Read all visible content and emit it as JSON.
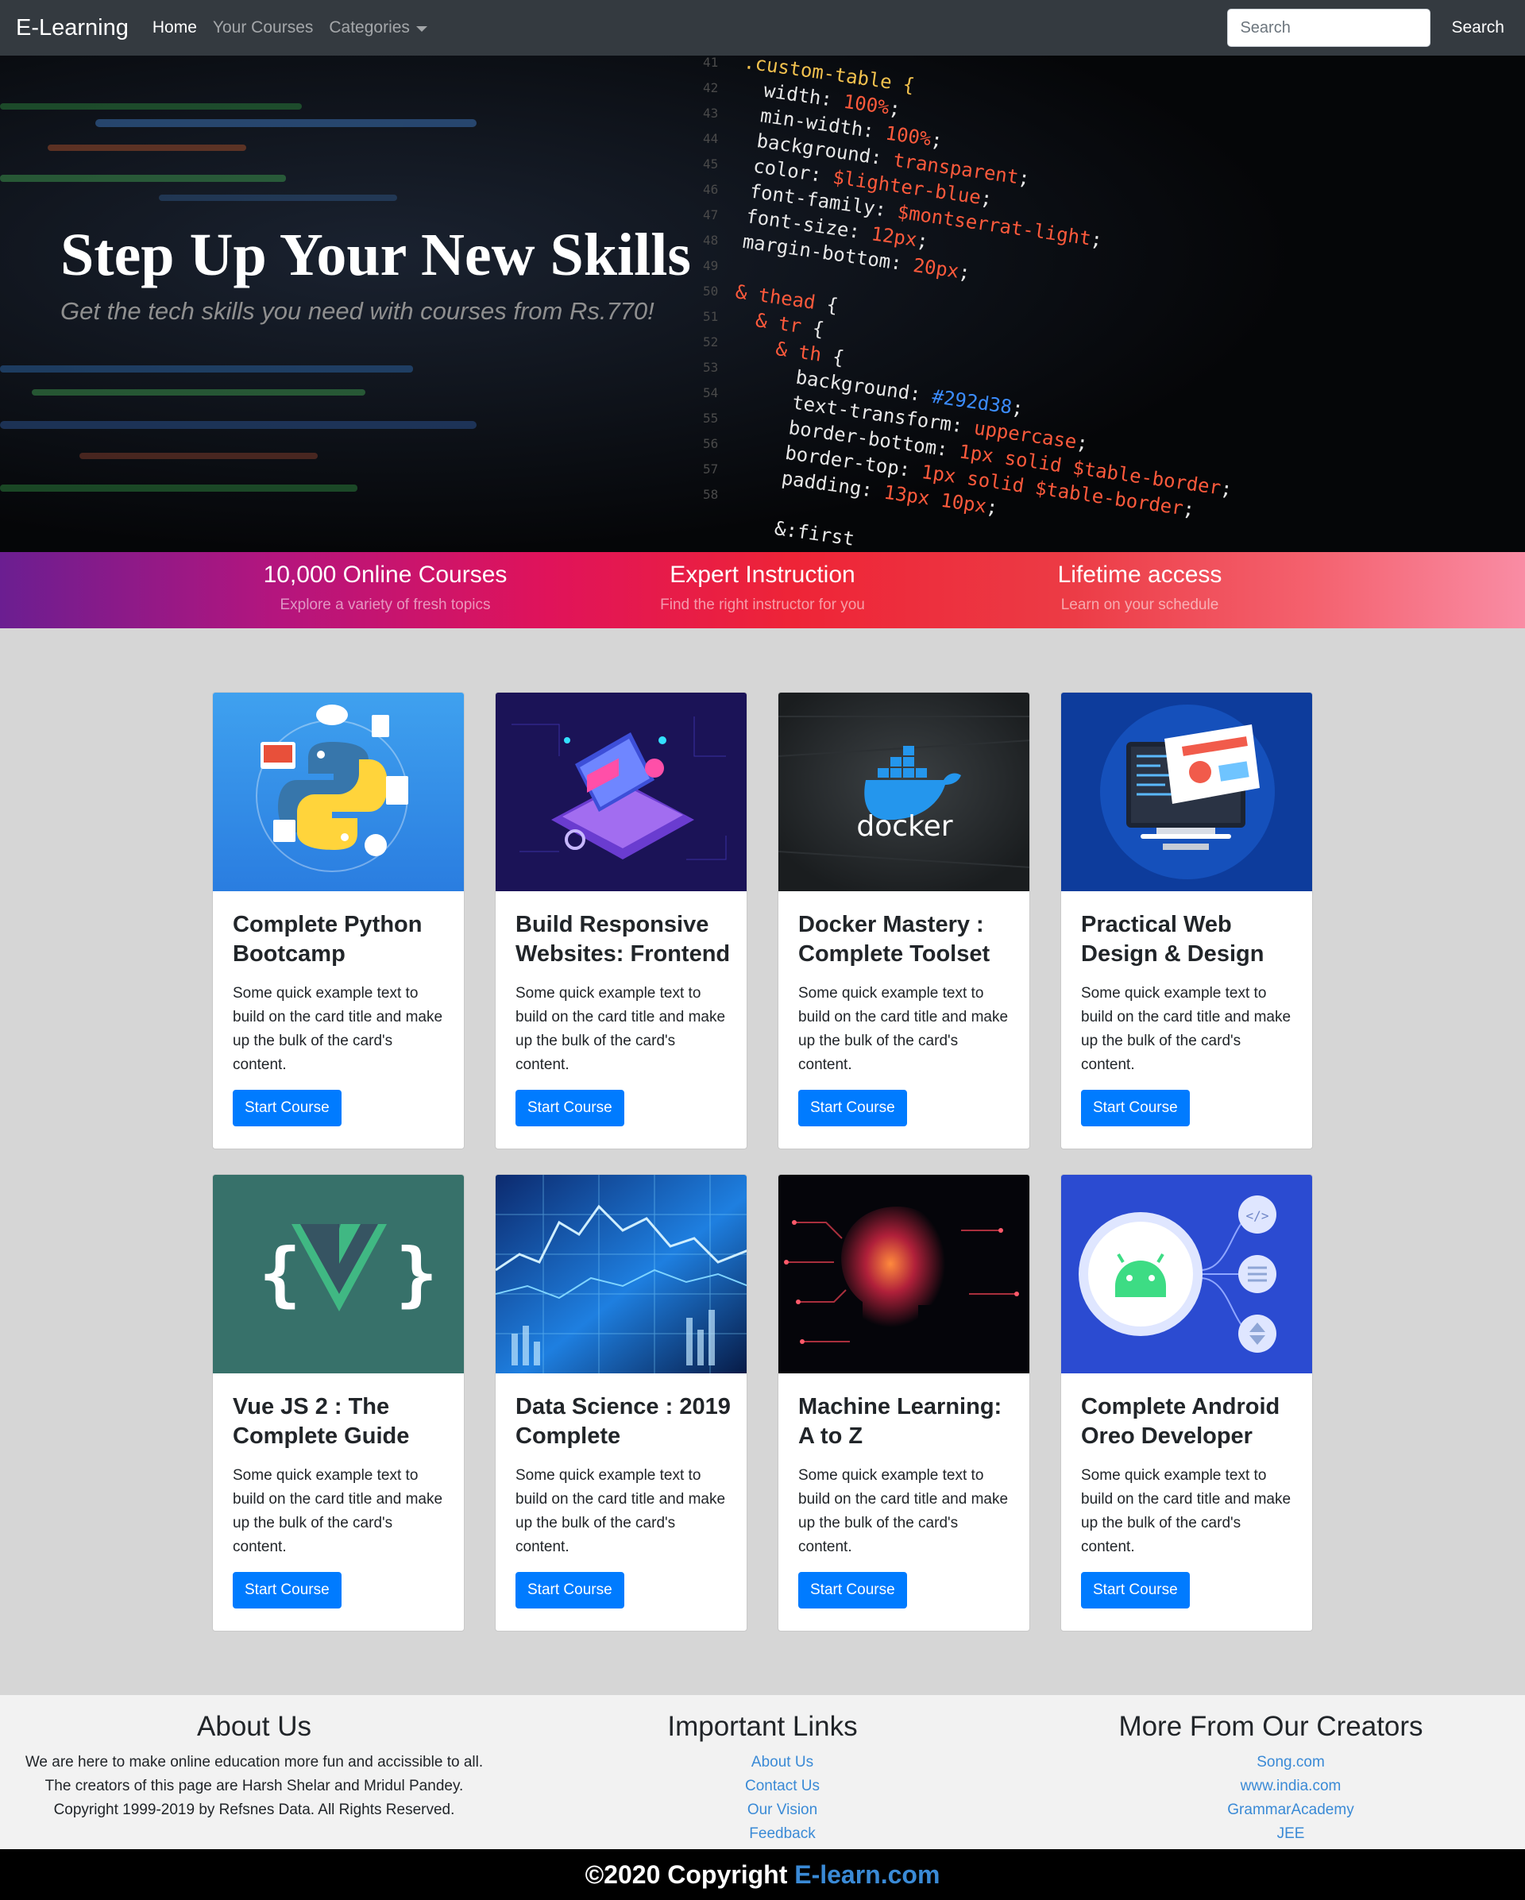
{
  "navbar": {
    "brand": "E-Learning",
    "links": [
      {
        "label": "Home"
      },
      {
        "label": "Your Courses"
      },
      {
        "label": "Categories"
      }
    ],
    "search_placeholder": "Search",
    "search_button": "Search"
  },
  "hero": {
    "title": "Step Up Your New Skills",
    "subtitle": "Get the tech skills you need with courses from Rs.770!"
  },
  "features": [
    {
      "title": "10,000 Online Courses",
      "subtitle": "Explore a variety of fresh topics"
    },
    {
      "title": "Expert Instruction",
      "subtitle": "Find the right instructor for you"
    },
    {
      "title": "Lifetime access",
      "subtitle": "Learn on your schedule"
    }
  ],
  "courses": [
    {
      "title": "Complete Python Bootcamp",
      "text": "Some quick example text to build on the card title and make up the bulk of the card's content.",
      "button": "Start Course",
      "image": "python-icon"
    },
    {
      "title": "Build Responsive Websites: Frontend",
      "text": "Some quick example text to build on the card title and make up the bulk of the card's content.",
      "button": "Start Course",
      "image": "isometric-laptop-icon"
    },
    {
      "title": "Docker Mastery : Complete Toolset",
      "text": "Some quick example text to build on the card title and make up the bulk of the card's content.",
      "button": "Start Course",
      "image": "docker-icon",
      "image_text": "docker"
    },
    {
      "title": "Practical Web Design & Design",
      "text": "Some quick example text to build on the card title and make up the bulk of the card's content.",
      "button": "Start Course",
      "image": "monitor-icon"
    },
    {
      "title": "Vue JS 2 : The Complete Guide",
      "text": "Some quick example text to build on the card title and make up the bulk of the card's content.",
      "button": "Start Course",
      "image": "vue-icon"
    },
    {
      "title": "Data Science : 2019 Complete",
      "text": "Some quick example text to build on the card title and make up the bulk of the card's content.",
      "button": "Start Course",
      "image": "data-chart-icon"
    },
    {
      "title": "Machine Learning: A to Z",
      "text": "Some quick example text to build on the card title and make up the bulk of the card's content.",
      "button": "Start Course",
      "image": "ai-head-icon"
    },
    {
      "title": "Complete Android Oreo Developer",
      "text": "Some quick example text to build on the card title and make up the bulk of the card's content.",
      "button": "Start Course",
      "image": "android-icon"
    }
  ],
  "footer": {
    "about": {
      "heading": "About Us",
      "text": "We are here to make online education more fun and accissible to all. The creators of this page are Harsh Shelar and Mridul Pandey. Copyright 1999-2019 by Refsnes Data. All Rights Reserved."
    },
    "links": {
      "heading": "Important Links",
      "items": [
        "About Us",
        "Contact Us",
        "Our Vision",
        "Feedback"
      ]
    },
    "creators": {
      "heading": "More From Our Creators",
      "items": [
        "Song.com",
        "www.india.com",
        "GrammarAcademy",
        "JEE"
      ]
    }
  },
  "copyright": {
    "text": "©2020 Copyright",
    "site": "E-learn.com"
  },
  "colors": {
    "navbar": "#343a40",
    "primary_button": "#007bff",
    "link": "#3a8ad6",
    "page_bg": "#d6d6d6",
    "footer_bg": "#f2f2f2"
  }
}
